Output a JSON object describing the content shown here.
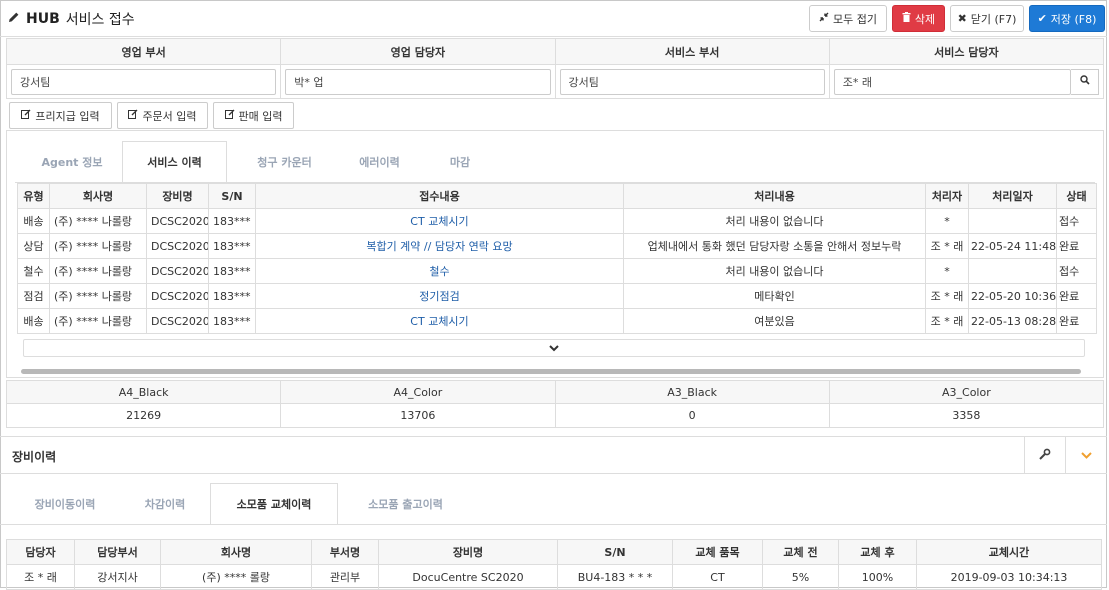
{
  "header": {
    "app": "HUB",
    "title": "서비스 접수",
    "buttons": {
      "collapse_all": "모두 접기",
      "delete": "삭제",
      "close": "닫기 (F7)",
      "save": "저장 (F8)"
    }
  },
  "staff": {
    "headers": [
      "영업 부서",
      "영업 담당자",
      "서비스 부서",
      "서비스 담당자"
    ],
    "values": [
      "강서팀",
      "박* 업",
      "강서팀",
      "조* 래"
    ]
  },
  "actions": {
    "free_supply": "프리지급 입력",
    "order": "주문서 입력",
    "sales": "판매 입력"
  },
  "service_tabs": [
    "Agent 정보",
    "서비스 이력",
    "청구 카운터",
    "에러이력",
    "마감"
  ],
  "service_table": {
    "columns": [
      "유형",
      "회사명",
      "장비명",
      "S/N",
      "접수내용",
      "처리내용",
      "처리자",
      "처리일자",
      "상태"
    ],
    "rows": [
      [
        "배송",
        "(주) **** 나롤랑",
        "DCSC2020",
        "183***",
        "CT 교체시기",
        "처리 내용이 없습니다",
        "*",
        "",
        "접수"
      ],
      [
        "상담",
        "(주) **** 나롤랑",
        "DCSC2020",
        "183***",
        "복합기 계약 // 담당자 연락 요망",
        "업체내에서 통화 했던 담당자랑 소통을 안해서 정보누락",
        "조 * 래",
        "22-05-24 11:48",
        "완료"
      ],
      [
        "철수",
        "(주) **** 나롤랑",
        "DCSC2020",
        "183***",
        "철수",
        "처리 내용이 없습니다",
        "*",
        "",
        "접수"
      ],
      [
        "점검",
        "(주) **** 나롤랑",
        "DCSC2020",
        "183***",
        "정기점검",
        "메타확인",
        "조 * 래",
        "22-05-20 10:36",
        "완료"
      ],
      [
        "배송",
        "(주) **** 나롤랑",
        "DCSC2020",
        "183***",
        "CT 교체시기",
        "여분있음",
        "조 * 래",
        "22-05-13 08:28",
        "완료"
      ]
    ]
  },
  "counters": {
    "headers": [
      "A4_Black",
      "A4_Color",
      "A3_Black",
      "A3_Color"
    ],
    "values": [
      "21269",
      "13706",
      "0",
      "3358"
    ]
  },
  "equipment": {
    "title": "장비이력",
    "tabs": [
      "장비이동이력",
      "차감이력",
      "소모품 교체이력",
      "소모품 출고이력"
    ],
    "columns": [
      "담당자",
      "담당부서",
      "회사명",
      "부서명",
      "장비명",
      "S/N",
      "교체 품목",
      "교체 전",
      "교체 후",
      "교체시간"
    ],
    "rows": [
      [
        "조 * 래",
        "강서지사",
        "(주)  ****  롤랑",
        "관리부",
        "DocuCentre SC2020",
        "BU4-183 * * *",
        "CT",
        "5%",
        "100%",
        "2019-09-03 10:34:13"
      ]
    ]
  },
  "colors": {
    "delete": "#e03b45",
    "save": "#1e7ad6",
    "link": "#1f5ea8",
    "inactive_tab": "#9aa5b5"
  }
}
